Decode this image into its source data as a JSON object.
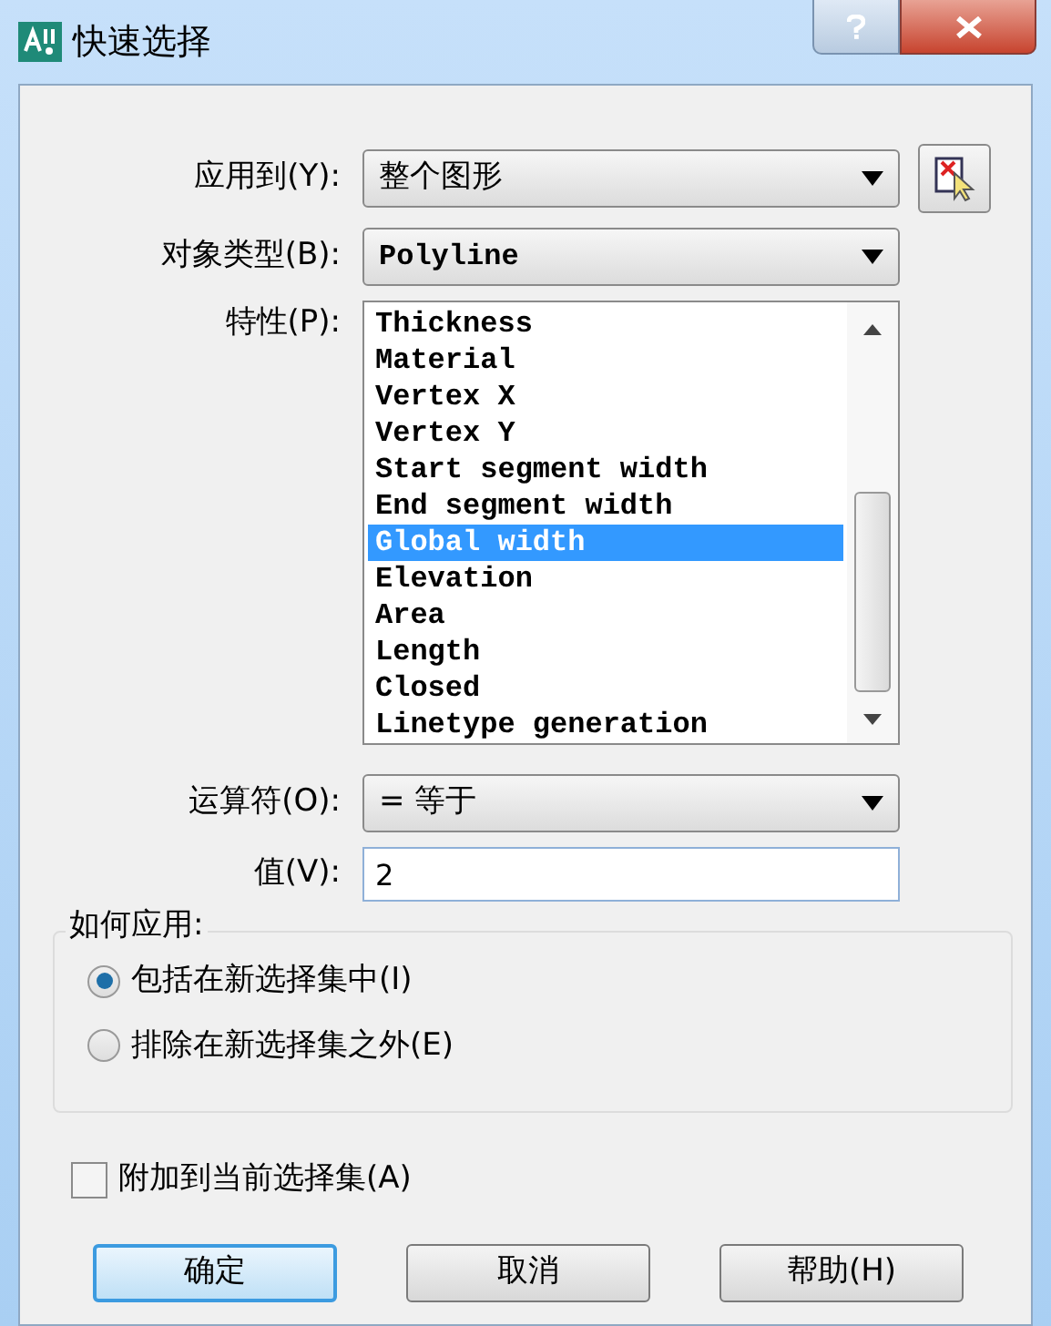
{
  "window": {
    "title": "快速选择"
  },
  "apply_to": {
    "label": "应用到(Y):",
    "value": "整个图形"
  },
  "object_type": {
    "label": "对象类型(B):",
    "value": "Polyline"
  },
  "properties": {
    "label": "特性(P):",
    "items": [
      {
        "label": "Thickness",
        "selected": false
      },
      {
        "label": "Material",
        "selected": false
      },
      {
        "label": "Vertex X",
        "selected": false
      },
      {
        "label": "Vertex Y",
        "selected": false
      },
      {
        "label": "Start segment width",
        "selected": false
      },
      {
        "label": "End segment width",
        "selected": false
      },
      {
        "label": "Global width",
        "selected": true
      },
      {
        "label": "Elevation",
        "selected": false
      },
      {
        "label": "Area",
        "selected": false
      },
      {
        "label": "Length",
        "selected": false
      },
      {
        "label": "Closed",
        "selected": false
      },
      {
        "label": "Linetype generation",
        "selected": false
      }
    ]
  },
  "operator": {
    "label": "运算符(O):",
    "value": "= 等于"
  },
  "value": {
    "label": "值(V):",
    "value": "2"
  },
  "how_to_apply": {
    "title": "如何应用:",
    "options": [
      {
        "label": "包括在新选择集中(I)",
        "selected": true
      },
      {
        "label": "排除在新选择集之外(E)",
        "selected": false
      }
    ]
  },
  "append": {
    "label": "附加到当前选择集(A)",
    "checked": false
  },
  "buttons": [
    {
      "label": "确定",
      "default": true
    },
    {
      "label": "取消",
      "default": false
    },
    {
      "label": "帮助(H)",
      "default": false
    }
  ]
}
